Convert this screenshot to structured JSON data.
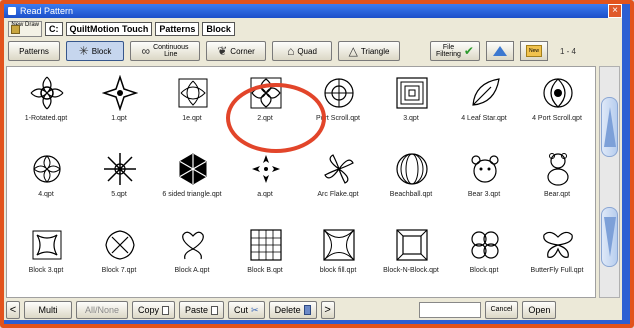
{
  "window": {
    "title": "Read Pattern",
    "close_glyph": "×"
  },
  "breadcrumb": {
    "new_draw": "New Draw",
    "items": [
      "C:",
      "QuiltMotion Touch",
      "Patterns",
      "Block"
    ]
  },
  "toolbar": {
    "patterns_label": "Patterns",
    "block_label": "Block",
    "continuous_line_label_1": "Continuous",
    "continuous_line_label_2": "Line",
    "corner_label": "Corner",
    "quad_label": "Quad",
    "triangle_label": "Triangle",
    "file_filtering_1": "File",
    "file_filtering_2": "Filtering",
    "new_label": "New",
    "page_range": "1 - 4"
  },
  "files": [
    {
      "name": "1-Rotated.qpt",
      "icon": "rotated-flower-icon"
    },
    {
      "name": "1.qpt",
      "icon": "cross-star-icon"
    },
    {
      "name": "1e.qpt",
      "icon": "swirl-block-icon"
    },
    {
      "name": "2.qpt",
      "icon": "square-knot-icon"
    },
    {
      "name": "Port Scroll.qpt",
      "icon": "scroll-medallion-icon"
    },
    {
      "name": "3.qpt",
      "icon": "maze-square-icon"
    },
    {
      "name": "4 Leaf Star.qpt",
      "icon": "leaf-icon"
    },
    {
      "name": "4 Port Scroll.qpt",
      "icon": "port-scroll-icon"
    },
    {
      "name": "4.qpt",
      "icon": "round-flower-icon"
    },
    {
      "name": "5.qpt",
      "icon": "snowflake-icon"
    },
    {
      "name": "6 sided triangle.qpt",
      "icon": "hexagon-icon"
    },
    {
      "name": "a.qpt",
      "icon": "arrow-star-icon"
    },
    {
      "name": "Arc Flake.qpt",
      "icon": "pinwheel-icon"
    },
    {
      "name": "Beachball.qpt",
      "icon": "beachball-icon"
    },
    {
      "name": "Bear 3.qpt",
      "icon": "bear-face-icon"
    },
    {
      "name": "Bear.qpt",
      "icon": "teddy-bear-icon"
    },
    {
      "name": "Block 3.qpt",
      "icon": "knot-block-icon"
    },
    {
      "name": "Block 7.qpt",
      "icon": "celtic-knot-icon"
    },
    {
      "name": "Block A.qpt",
      "icon": "heart-block-icon"
    },
    {
      "name": "Block B.qpt",
      "icon": "lattice-block-icon"
    },
    {
      "name": "block fill.qpt",
      "icon": "fill-block-icon"
    },
    {
      "name": "Block-N-Block.qpt",
      "icon": "nested-block-icon"
    },
    {
      "name": "Block.qpt",
      "icon": "clover-block-icon"
    },
    {
      "name": "ButterFly Full.qpt",
      "icon": "butterfly-icon"
    }
  ],
  "bottom": {
    "multi": "Multi",
    "all_none": "All/None",
    "copy": "Copy",
    "paste": "Paste",
    "cut": "Cut",
    "delete": "Delete",
    "cancel": "Cancel",
    "open": "Open",
    "prev": "<",
    "next": ">"
  },
  "colors": {
    "frame": "#e2531c",
    "titlebar": "#1c4fc9",
    "highlight_ring": "#e2452a"
  }
}
